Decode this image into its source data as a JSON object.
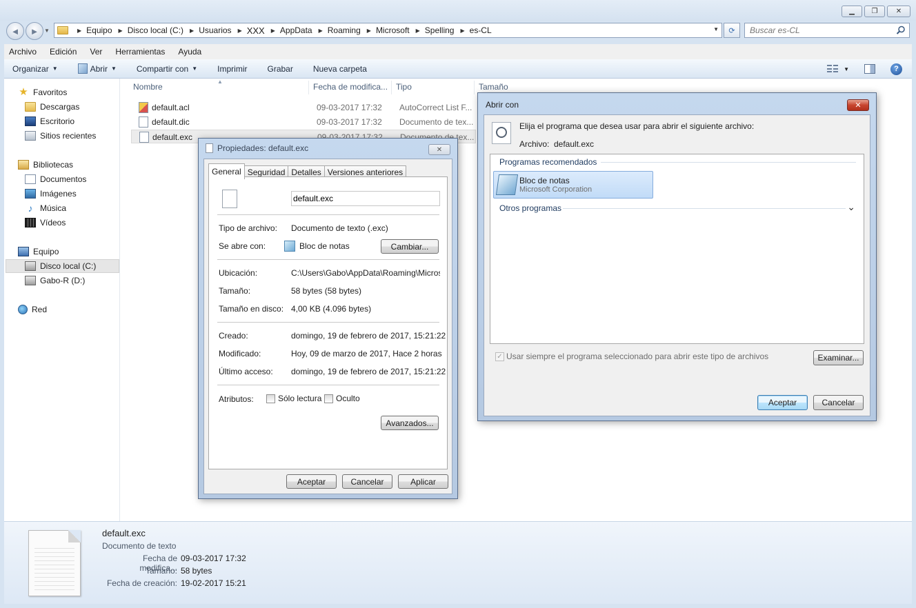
{
  "window": {
    "minimize_glyph": "▁",
    "maximize_glyph": "❐",
    "close_glyph": "✕"
  },
  "nav": {
    "back_glyph": "◄",
    "forward_glyph": "►",
    "refresh_glyph": "⟳"
  },
  "address": {
    "crumbs": [
      "Equipo",
      "Disco local (C:)",
      "Usuarios",
      "XXX",
      "AppData",
      "Roaming",
      "Microsoft",
      "Spelling",
      "es-CL"
    ]
  },
  "search": {
    "placeholder": "Buscar es-CL"
  },
  "menu": {
    "items": [
      "Archivo",
      "Edición",
      "Ver",
      "Herramientas",
      "Ayuda"
    ]
  },
  "toolbar": {
    "organize": "Organizar",
    "open": "Abrir",
    "share": "Compartir con",
    "print": "Imprimir",
    "burn": "Grabar",
    "new_folder": "Nueva carpeta",
    "help_glyph": "?"
  },
  "navpane": {
    "favorites": "Favoritos",
    "downloads": "Descargas",
    "desktop": "Escritorio",
    "recent": "Sitios recientes",
    "libraries": "Bibliotecas",
    "documents": "Documentos",
    "images": "Imágenes",
    "music": "Música",
    "videos": "Vídeos",
    "computer": "Equipo",
    "local_disk": "Disco local (C:)",
    "drive_d": "Gabo-R (D:)",
    "network": "Red"
  },
  "filelist": {
    "columns": {
      "name": "Nombre",
      "date": "Fecha de modifica...",
      "type": "Tipo",
      "size": "Tamaño"
    },
    "rows": [
      {
        "name": "default.acl",
        "date": "09-03-2017 17:32",
        "type": "AutoCorrect List F..."
      },
      {
        "name": "default.dic",
        "date": "09-03-2017 17:32",
        "type": "Documento de tex..."
      },
      {
        "name": "default.exc",
        "date": "09-03-2017 17:32",
        "type": "Documento de tex..."
      }
    ]
  },
  "details": {
    "name": "default.exc",
    "type": "Documento de texto",
    "modified_label": "Fecha de modifica...",
    "modified": "09-03-2017 17:32",
    "size_label": "Tamaño:",
    "size": "58 bytes",
    "created_label": "Fecha de creación:",
    "created": "19-02-2017 15:21"
  },
  "props": {
    "title": "Propiedades: default.exc",
    "close_glyph": "✕",
    "tabs": [
      "General",
      "Seguridad",
      "Detalles",
      "Versiones anteriores"
    ],
    "filename": "default.exc",
    "type_label": "Tipo de archivo:",
    "type_value": "Documento de texto (.exc)",
    "opens_label": "Se abre con:",
    "opens_value": "Bloc de notas",
    "change_button": "Cambiar...",
    "location_label": "Ubicación:",
    "location_value": "C:\\Users\\Gabo\\AppData\\Roaming\\Microsoft\\",
    "size_label": "Tamaño:",
    "size_value": "58 bytes (58 bytes)",
    "disk_size_label": "Tamaño en disco:",
    "disk_size_value": "4,00 KB (4.096 bytes)",
    "created_label": "Creado:",
    "created_value": "domingo, 19 de febrero de 2017, 15:21:22",
    "modified_label": "Modificado:",
    "modified_value": "Hoy, 09 de marzo de 2017, Hace 2 horas",
    "accessed_label": "Último acceso:",
    "accessed_value": "domingo, 19 de febrero de 2017, 15:21:22",
    "attributes_label": "Atributos:",
    "readonly_label": "Sólo lectura",
    "hidden_label": "Oculto",
    "advanced_button": "Avanzados...",
    "ok_button": "Aceptar",
    "cancel_button": "Cancelar",
    "apply_button": "Aplicar"
  },
  "openwith": {
    "title": "Abrir con",
    "close_glyph": "✕",
    "instruction": "Elija el programa que desea usar para abrir el siguiente archivo:",
    "file_label": "Archivo:",
    "file_value": "default.exc",
    "recommended_title": "Programas recomendados",
    "program_name": "Bloc de notas",
    "program_publisher": "Microsoft Corporation",
    "other_title": "Otros programas",
    "expand_glyph": "⌄",
    "always_use_label": "Usar siempre el programa seleccionado para abrir este tipo de archivos",
    "browse_button": "Examinar...",
    "ok_button": "Aceptar",
    "cancel_button": "Cancelar"
  }
}
